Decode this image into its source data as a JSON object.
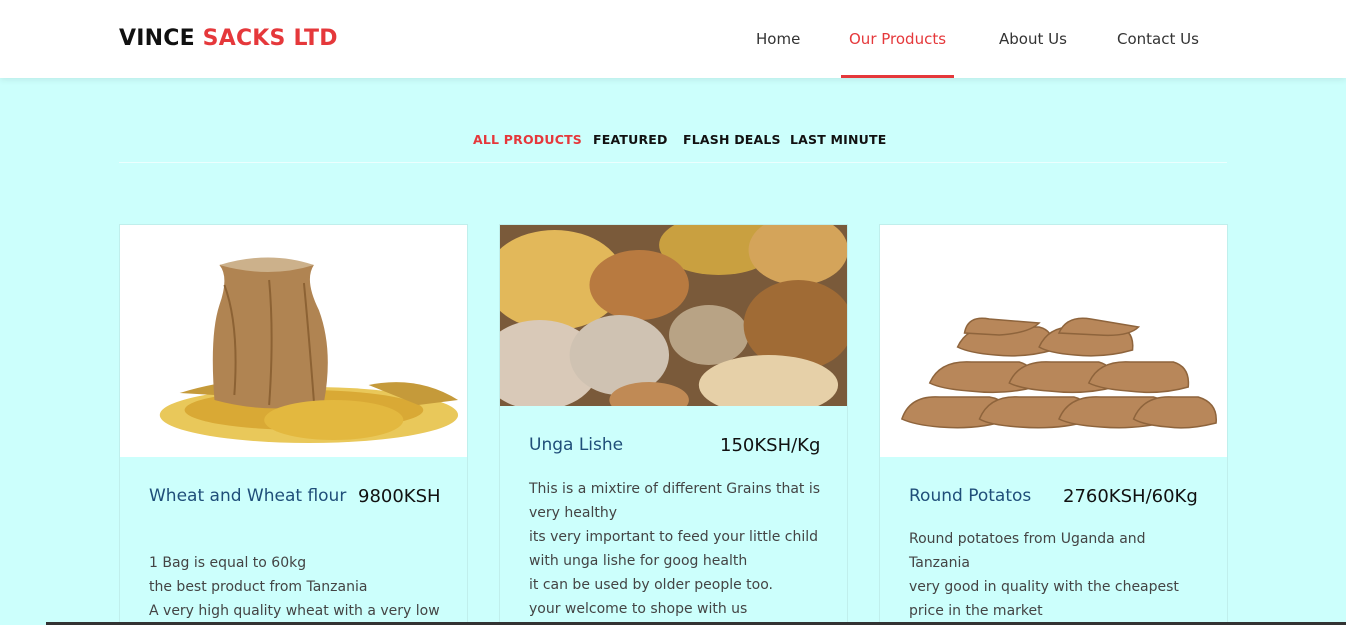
{
  "header": {
    "brand_part1": "VINCE ",
    "brand_part2": "SACKS LTD",
    "nav": [
      {
        "label": "Home",
        "active": false
      },
      {
        "label": "Our Products",
        "active": true
      },
      {
        "label": "About Us",
        "active": false
      },
      {
        "label": "Contact Us",
        "active": false
      }
    ]
  },
  "filters": [
    {
      "label": "ALL PRODUCTS",
      "active": true
    },
    {
      "label": "FEATURED",
      "active": false
    },
    {
      "label": "FLASH DEALS",
      "active": false
    },
    {
      "label": "LAST MINUTE",
      "active": false
    }
  ],
  "products": [
    {
      "name": "Wheat and Wheat flour",
      "price": "9800KSH",
      "description": [
        "1 Bag is equal to 60kg",
        "the best product from Tanzania",
        "A very high quality wheat with a very low"
      ]
    },
    {
      "name": "Unga Lishe",
      "price": "150KSH/Kg",
      "description": [
        "This is a mixtire of different Grains that is",
        "very healthy",
        "its very important to feed your little child",
        "with unga lishe for goog health",
        "it can be used by older people too.",
        "your welcome to shope with us"
      ]
    },
    {
      "name": "Round Potatos",
      "price": "2760KSH/60Kg",
      "description": [
        "Round potatoes from Uganda and",
        "Tanzania",
        "very good in quality with the cheapest",
        "price in the market"
      ]
    }
  ],
  "colors": {
    "accent": "#e5383b",
    "background": "#ccfffc",
    "title_blue": "#1f4e79"
  }
}
